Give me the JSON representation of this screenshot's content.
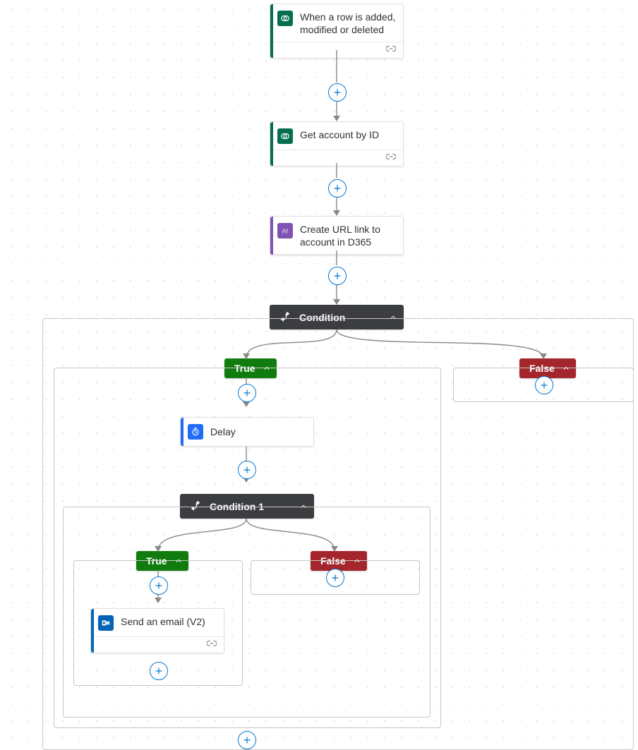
{
  "colors": {
    "dataverse": "#066e50",
    "variable": "#8053b3",
    "schedule": "#1f6cf9",
    "outlook": "#0364b8",
    "condition_bg": "#3b3d41",
    "true": "#107c10",
    "false": "#a4262c"
  },
  "nodes": {
    "trigger": {
      "label": "When a row is added, modified or deleted",
      "icon": "dataverse"
    },
    "getacct": {
      "label": "Get account by ID",
      "icon": "dataverse"
    },
    "createurl": {
      "label": "Create URL link to account in D365",
      "icon": "variable"
    },
    "cond1": {
      "label": "Condition"
    },
    "delay": {
      "label": "Delay",
      "icon": "schedule"
    },
    "cond2": {
      "label": "Condition 1"
    },
    "sendmail": {
      "label": "Send an email (V2)",
      "icon": "outlook"
    }
  },
  "branches": {
    "true_label": "True",
    "false_label": "False"
  }
}
